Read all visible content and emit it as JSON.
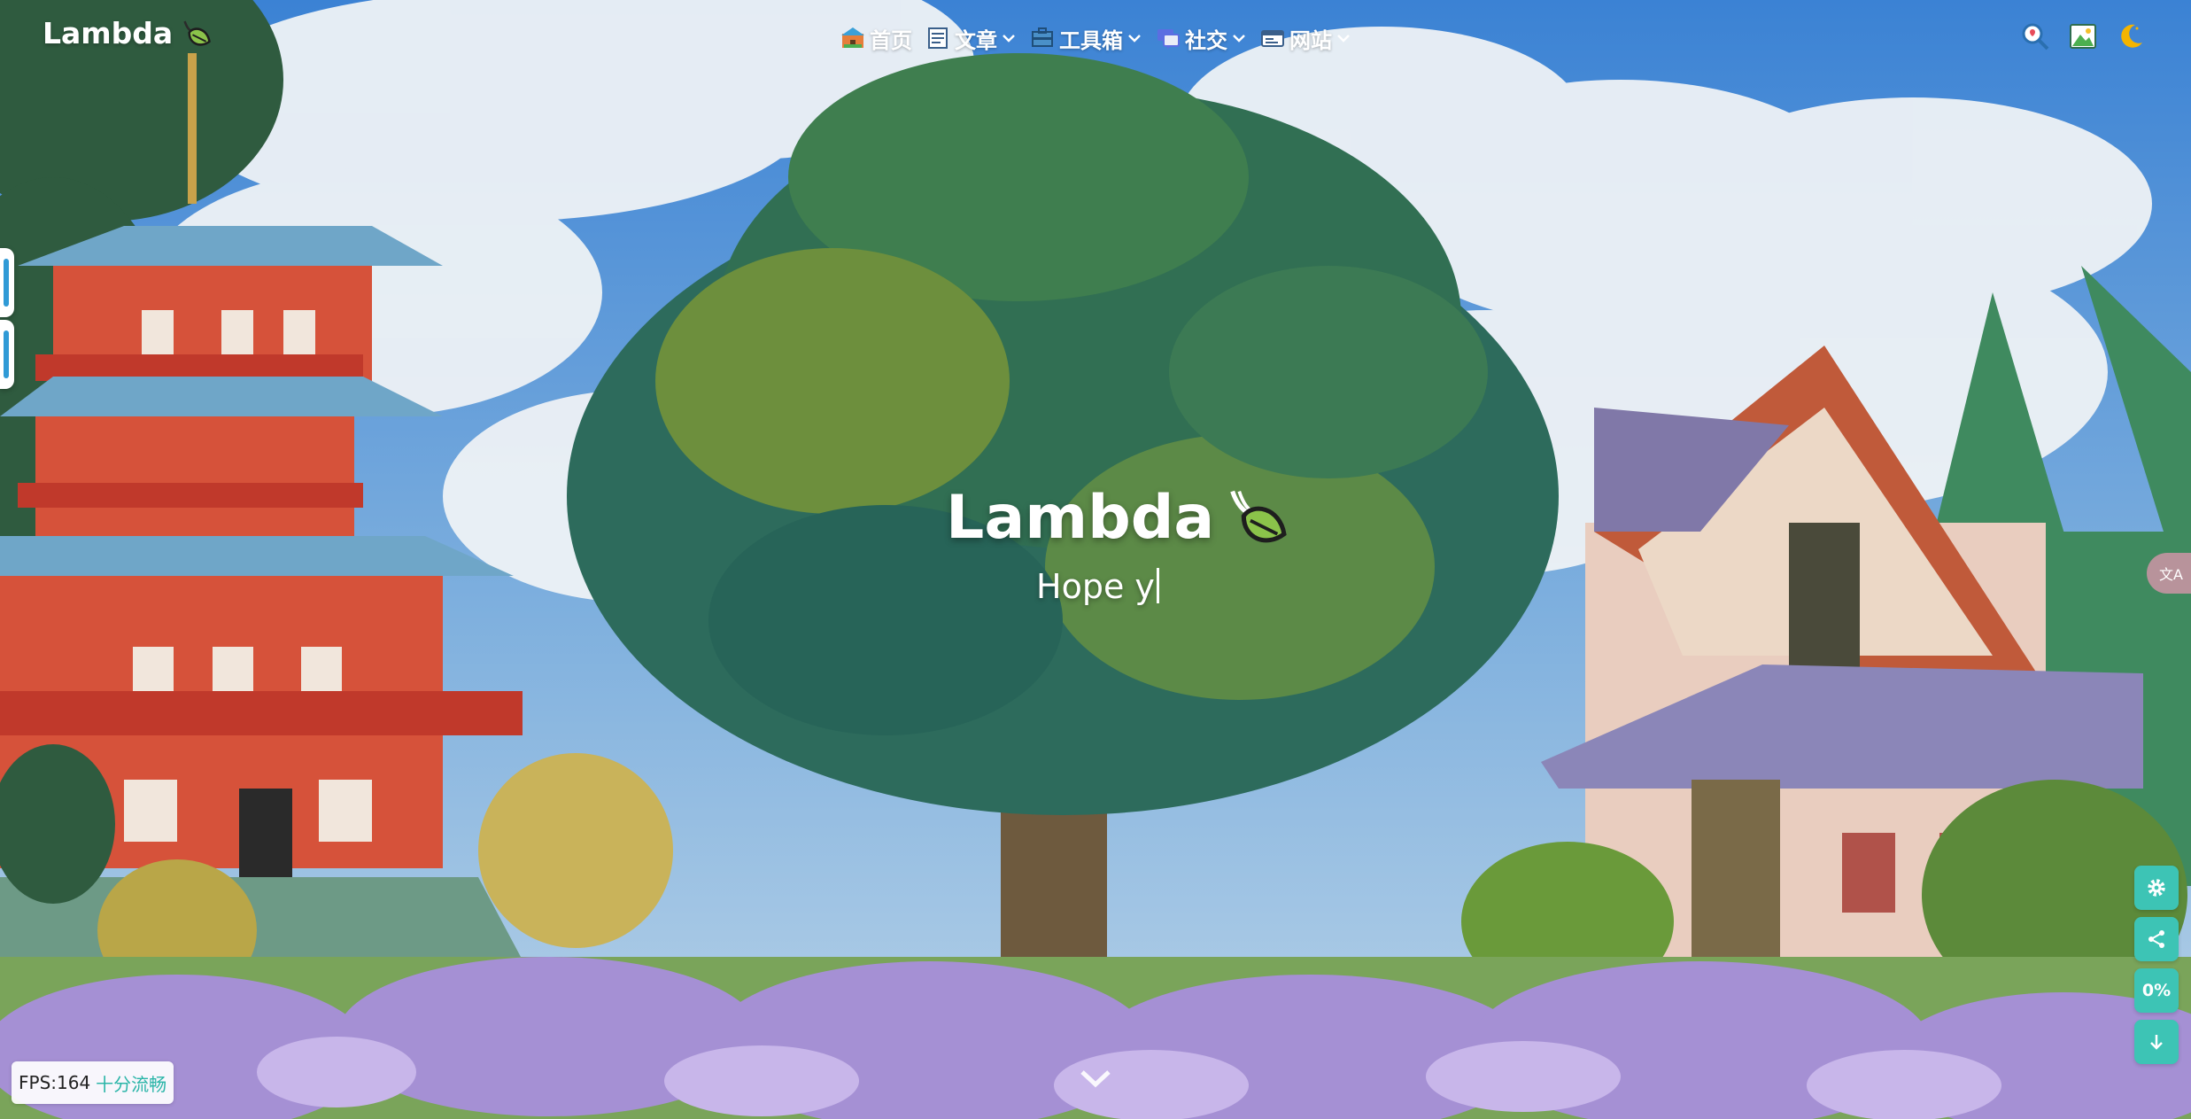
{
  "header": {
    "site_title": "Lambda",
    "logo_icon": "leaf-icon",
    "menu": [
      {
        "label": "首页",
        "icon": "home-icon",
        "has_dropdown": false
      },
      {
        "label": "文章",
        "icon": "article-icon",
        "has_dropdown": true
      },
      {
        "label": "工具箱",
        "icon": "toolbox-icon",
        "has_dropdown": true
      },
      {
        "label": "社交",
        "icon": "chat-icon",
        "has_dropdown": true
      },
      {
        "label": "网站",
        "icon": "website-icon",
        "has_dropdown": true
      }
    ],
    "tools": [
      "search-icon",
      "wallpaper-icon",
      "dark-mode-icon"
    ]
  },
  "hero": {
    "title": "Lambda",
    "subtitle": "Hope y"
  },
  "side": {
    "translate_label": "文A"
  },
  "float_buttons": [
    {
      "name": "settings-button",
      "icon": "gear-icon",
      "label": ""
    },
    {
      "name": "share-button",
      "icon": "share-icon",
      "label": ""
    },
    {
      "name": "scroll-progress-button",
      "icon": "",
      "label": "0%"
    },
    {
      "name": "scroll-down-button",
      "icon": "arrow-down-icon",
      "label": ""
    }
  ],
  "fps": {
    "label": "FPS:164",
    "status": "十分流畅"
  },
  "colors": {
    "accent": "#3dc4b5",
    "sky": "#3a7fd0",
    "leaf": "#8bc34a",
    "tree": "#2e6e5a",
    "flowers": "#9b83c8"
  }
}
